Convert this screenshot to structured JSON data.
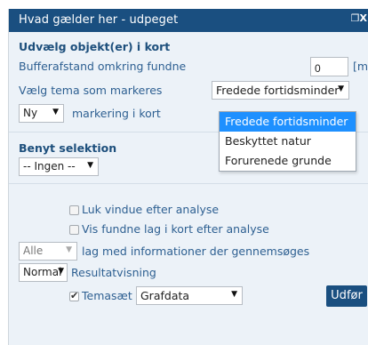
{
  "window": {
    "title": "Hvad gælder her - udpeget",
    "window_button": "❐X"
  },
  "select_objects": {
    "heading": "Udvælg objekt(er) i kort",
    "buffer_label": "Bufferafstand omkring fundne",
    "buffer_value": "0",
    "buffer_unit": "[m]",
    "theme_label": "Vælg tema som markeres",
    "theme_selected": "Fredede fortidsminder",
    "theme_options": [
      "Fredede fortidsminder",
      "Beskyttet natur",
      "Forurenede grunde"
    ],
    "marking_selected": "Ny",
    "marking_label": "markering i kort"
  },
  "selection": {
    "heading": "Benyt selektion",
    "selected": "-- Ingen --"
  },
  "options": {
    "close_window_label": "Luk vindue efter analyse",
    "close_window_checked": false,
    "show_layers_label": "Vis fundne lag i kort efter analyse",
    "show_layers_checked": false,
    "layers_selected": "Alle",
    "layers_label": "lag med informationer der gennemsøges",
    "result_selected": "Normal",
    "result_label": "Resultatvisning",
    "themeset_checked": true,
    "themeset_label": "Temasæt",
    "themeset_selected": "Grafdata",
    "run_button": "Udfør"
  },
  "colors": {
    "titlebar": "#1a4f80",
    "panel": "#ecf2f8",
    "label": "#2d5f91",
    "highlight": "#1e90ff"
  }
}
